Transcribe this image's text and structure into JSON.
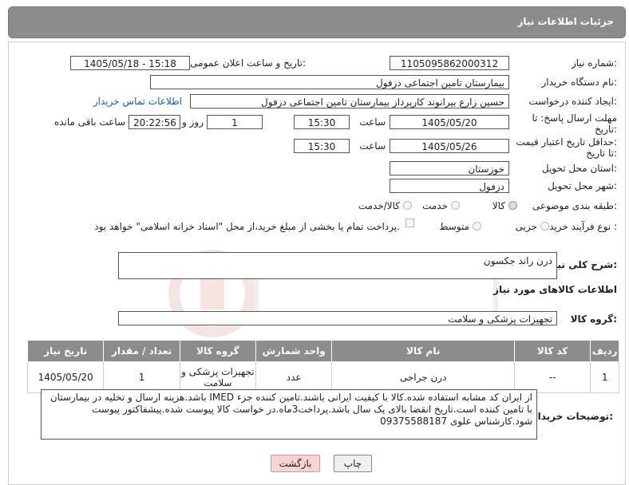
{
  "header": {
    "title": "جزئیات اطلاعات نیاز"
  },
  "form": {
    "need_number_label": "شماره نیاز:",
    "need_number": "1105095862000312",
    "announce_label": "تاریخ و ساعت اعلان عمومی:",
    "announce_value": "1405/05/18 - 15:18",
    "buyer_org_label": "نام دستگاه خریدار:",
    "buyer_org": "بیمارستان تامین اجتماعی دزفول",
    "creator_label": "ایجاد کننده درخواست:",
    "creator": "حسین زارع بیرانوند کارپرداز بیمارستان تامین اجتماعی دزفول",
    "contact_link": "اطلاعات تماس خریدار",
    "deadline_label_1": "مهلت ارسال پاسخ: تا",
    "deadline_label_2": "تاریخ:",
    "deadline_date": "1405/05/20",
    "time_label": "ساعت",
    "deadline_time": "15:30",
    "days_value": "1",
    "days_label": "روز و",
    "remaining_time": "20:22:56",
    "remaining_label": "ساعت باقی مانده",
    "validity_label_1": "حداقل تاریخ اعتبار قیمت:",
    "validity_label_2": "تا تاریخ:",
    "validity_date": "1405/05/26",
    "validity_time": "15:30",
    "province_label": "استان محل تحویل:",
    "province": "خوزستان",
    "city_label": "شهر محل تحویل:",
    "city": "دزفول",
    "category_label": "طبقه بندی موضوعی:",
    "category_options": [
      "کالا",
      "خدمت",
      "کالا/خدمت"
    ],
    "category_selected": "کالا",
    "process_label": "نوع فرآیند خرید :",
    "process_options": [
      "جزیی",
      "متوسط"
    ],
    "payment_note": "پرداخت تمام یا بخشی از مبلغ خرید،از محل \"اسناد خزانه اسلامی\" خواهد بود."
  },
  "summary": {
    "label": "شرح کلی نیاز:",
    "value": "درن راند جکسون"
  },
  "items_section": {
    "title": "اطلاعات کالاهای مورد نیاز",
    "group_label": "گروه کالا:",
    "group_value": "تجهیزات پزشکی و سلامت",
    "columns": [
      "ردیف",
      "کد کالا",
      "نام کالا",
      "واحد شمارش",
      "گروه کالا",
      "تعداد / مقدار",
      "تاریخ نیاز"
    ],
    "rows": [
      {
        "row": "1",
        "code": "--",
        "name": "درن جراحی",
        "unit": "عدد",
        "group": "تجهیزات پزشکی و سلامت",
        "qty": "1",
        "date": "1405/05/20"
      }
    ]
  },
  "buyer_notes": {
    "label": "توضیحات خریدار:",
    "text": "از ایران کد مشابه استفاده شده.کالا با کیفیت ایرانی باشند.تامین کننده جزء IMED باشد.هزینه ارسال و تخلیه در بیمارستان با تامین کننده است.تاریخ انقضا بالای یک سال باشد.پرداخت3ماه.در خواست کالا پیوست شده.پیشفاکتور پیوست شود.کارشناس علوی 09375588187"
  },
  "buttons": {
    "print": "چاپ",
    "back": "بازگشت"
  },
  "colors": {
    "header_bg": "#8c8c8c",
    "link": "#1a5bb5",
    "back_btn_bg": "#f7d4d4"
  }
}
